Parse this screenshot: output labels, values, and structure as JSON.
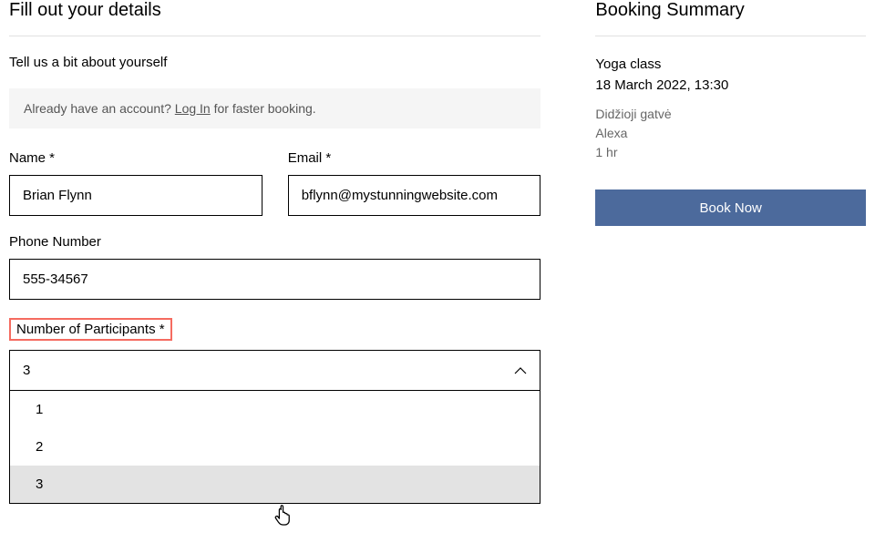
{
  "form": {
    "title": "Fill out your details",
    "subtitle": "Tell us a bit about yourself",
    "login_prompt_pre": "Already have an account? ",
    "login_link": "Log In",
    "login_prompt_post": " for faster booking.",
    "name_label": "Name *",
    "name_value": "Brian Flynn",
    "email_label": "Email *",
    "email_value": "bflynn@mystunningwebsite.com",
    "phone_label": "Phone Number",
    "phone_value": "555-34567",
    "participants_label": "Number of Participants *",
    "participants_selected": "3",
    "participants_options": [
      "1",
      "2",
      "3"
    ]
  },
  "summary": {
    "title": "Booking Summary",
    "service": "Yoga class",
    "datetime": "18 March 2022, 13:30",
    "location": "Didžioji gatvė",
    "staff": "Alexa",
    "duration": "1 hr",
    "book_label": "Book Now"
  }
}
